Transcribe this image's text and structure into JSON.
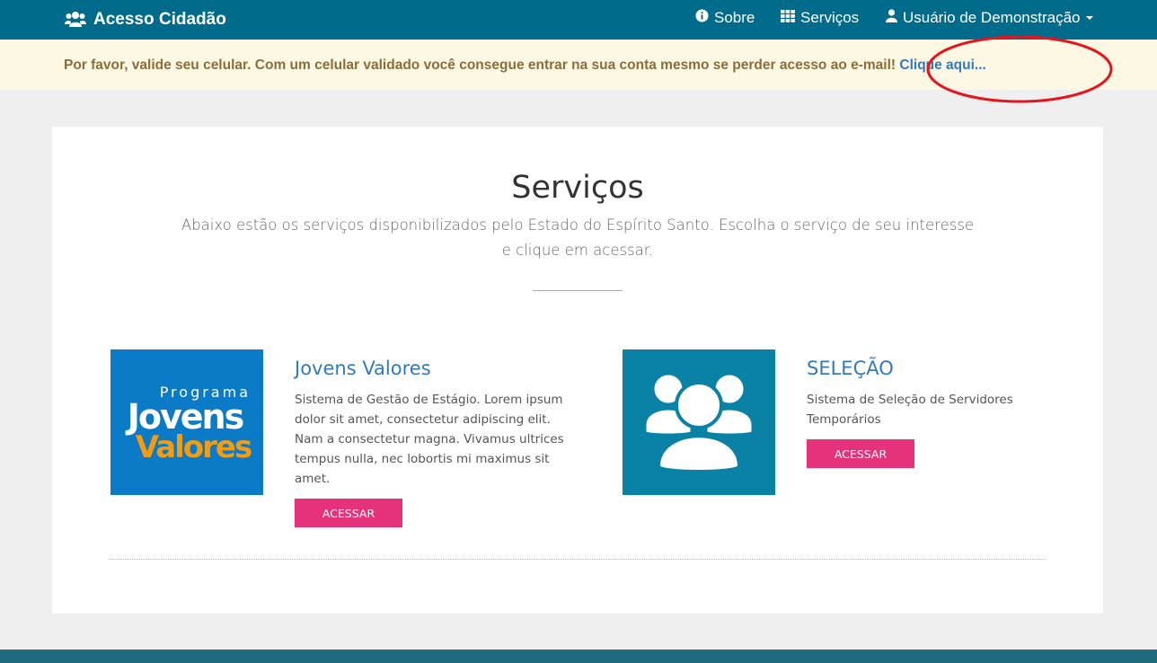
{
  "navbar": {
    "brand_label": "Acesso Cidadão",
    "items": [
      {
        "label": "Sobre",
        "icon": "info-circle-icon"
      },
      {
        "label": "Serviços",
        "icon": "grid-icon"
      },
      {
        "label": "Usuário de Demonstração",
        "icon": "user-icon"
      }
    ],
    "background": "#006b8a"
  },
  "alert": {
    "message": "Por favor, valide seu celular. Com um celular validado você consegue entrar na sua conta mesmo se perder acesso ao e-mail!",
    "link_label": "Clique aqui...",
    "background": "#fcf8e3",
    "highlight_color": "#e8141b"
  },
  "main": {
    "title": "Serviços",
    "subtitle": "Abaixo estão os serviços disponibilizados pelo Estado do Espírito Santo. Escolha o serviço de seu interesse e clique em acessar.",
    "services": [
      {
        "title": "Jovens Valores",
        "description": "Sistema de Gestão de Estágio. Lorem ipsum dolor sit amet, consectetur adipiscing elit. Nam a consectetur magna. Vivamus ultrices tempus nulla, nec lobortis mi maximus sit amet.",
        "button_label": "ACESSAR",
        "logo_lines": [
          "Programa",
          "Jovens",
          "Valores"
        ],
        "logo_background": "#0b7ac7"
      },
      {
        "title": "SELEÇÃO",
        "description": "Sistema de Seleção de Servidores Temporários",
        "button_label": "ACESSAR",
        "icon": "users-group-icon",
        "logo_background": "#0a82a6"
      }
    ],
    "button_color": "#e6327a"
  }
}
